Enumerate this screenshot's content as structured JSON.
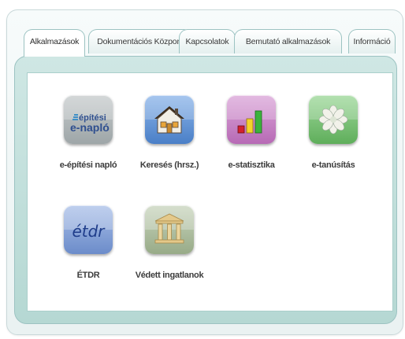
{
  "tabs": [
    {
      "label": "Alkalmazások",
      "active": true
    },
    {
      "label": "Dokumentációs Központ",
      "active": false
    },
    {
      "label": "Kapcsolatok",
      "active": false
    },
    {
      "label": "Bemutató alkalmazások",
      "active": false
    },
    {
      "label": "Információ",
      "active": false
    }
  ],
  "apps": [
    {
      "label": "e-építési napló",
      "icon": "e-epitesi-naplo-logo-icon",
      "icon_text_top": "építési",
      "icon_text_bottom": "e-napló"
    },
    {
      "label": "Keresés (hrsz.)",
      "icon": "house-icon"
    },
    {
      "label": "e-statisztika",
      "icon": "bar-chart-icon"
    },
    {
      "label": "e-tanúsítás",
      "icon": "flower-icon"
    },
    {
      "label": "ÉTDR",
      "icon": "etdr-logo-icon",
      "icon_text": "étdr"
    },
    {
      "label": "Védett ingatlanok",
      "icon": "columns-building-icon"
    }
  ],
  "colors": {
    "tab_border": "#9cc3c2",
    "panel_bg": "#c3dfdb",
    "icon_gray": "#a9b0b1",
    "icon_blue": "#5c93d6",
    "icon_purple": "#c77fc6",
    "icon_green": "#6fbf6a",
    "icon_etdr": "#7a99d3",
    "icon_sage": "#aebf9e"
  }
}
